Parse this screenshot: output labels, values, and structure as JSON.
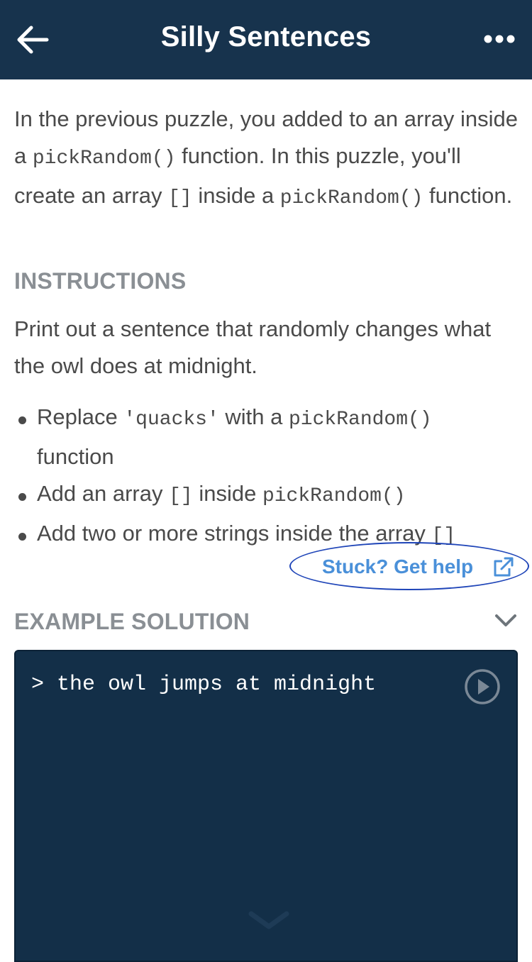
{
  "header": {
    "title": "Silly Sentences",
    "back_icon": "arrow-left-icon",
    "more_icon": "ellipsis-icon"
  },
  "intro": {
    "t1": "In the previous puzzle, you added to an array inside a ",
    "c1": "pickRandom()",
    "t2": " function. In this puzzle, you'll create an array ",
    "c2": "[]",
    "t3": " inside a ",
    "c3": "pickRandom()",
    "t4": " function."
  },
  "instructions": {
    "title": "INSTRUCTIONS",
    "text": "Print out a sentence that randomly changes what the owl does at midnight.",
    "bullets": [
      {
        "t1": "Replace ",
        "c1": "'quacks'",
        "t2": " with a ",
        "c2": "pickRandom()",
        "t3": " function"
      },
      {
        "t1": "Add an array ",
        "c1": "[]",
        "t2": " inside ",
        "c2": "pickRandom()"
      },
      {
        "t1": "Add two or more strings inside the array ",
        "c1": "[]"
      }
    ]
  },
  "help": {
    "label": "Stuck? Get help",
    "icon": "external-link-icon"
  },
  "example": {
    "title": "EXAMPLE SOLUTION",
    "toggle_icon": "chevron-down-icon",
    "console_output": "> the owl jumps at midnight",
    "play_icon": "play-circle-icon"
  },
  "colors": {
    "header_bg": "#17334d",
    "console_bg": "#132f48",
    "link": "#4a90d9",
    "section_title": "#8a8f94",
    "highlight_ring": "#1f45b8"
  }
}
